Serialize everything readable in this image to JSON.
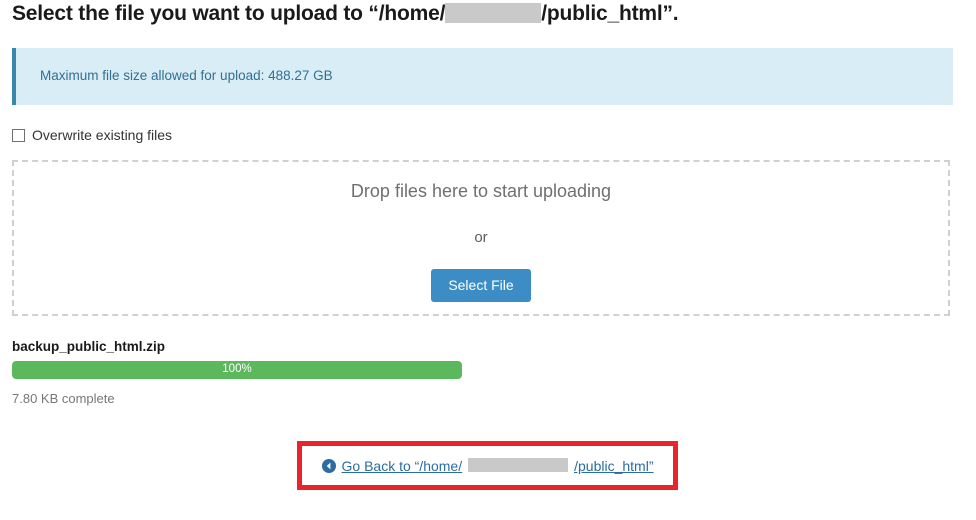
{
  "page": {
    "title_prefix": "Select the file you want to upload to “/home/",
    "title_suffix": "/public_html”.",
    "redacted_segment": ""
  },
  "info_banner": {
    "icon": "info-icon",
    "message": "Maximum file size allowed for upload: 488.27 GB",
    "background_color": "#d9edf7",
    "border_color": "#3a87ad",
    "text_color": "#31708f"
  },
  "overwrite": {
    "label": "Overwrite existing files",
    "checked": false
  },
  "dropzone": {
    "headline": "Drop files here to start uploading",
    "or_label": "or",
    "select_file_label": "Select File",
    "button_color": "#3c8dc5",
    "border_style": "dashed",
    "border_color": "#d0d0d0"
  },
  "upload": {
    "filename": "backup_public_html.zip",
    "progress_percent": "100%",
    "progress_value": 100,
    "bar_color": "#5cb85c",
    "status": "7.80 KB complete"
  },
  "go_back": {
    "icon": "arrow-circle-left-icon",
    "text_prefix": "Go Back to “/home/",
    "text_suffix": "/public_html”",
    "redacted_segment": "",
    "link_color": "#2b6ca3",
    "highlight_color": "#e8252a"
  }
}
